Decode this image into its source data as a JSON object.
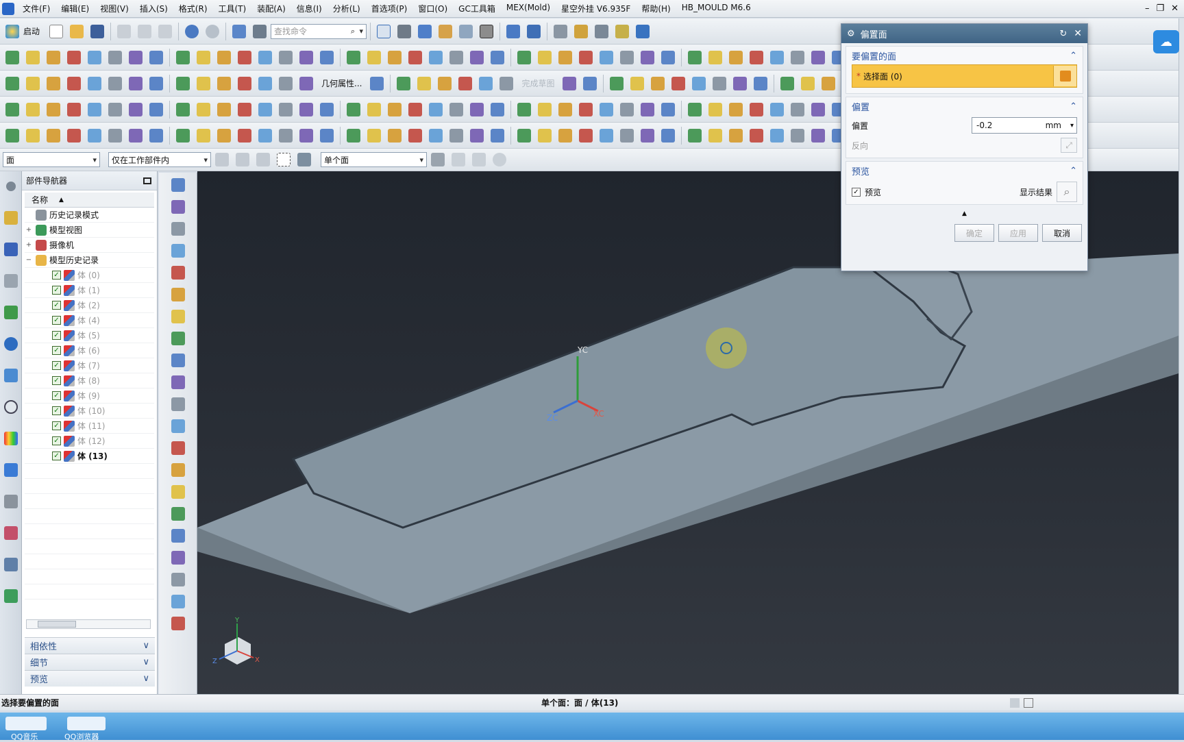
{
  "menubar": {
    "items": [
      "文件(F)",
      "编辑(E)",
      "视图(V)",
      "插入(S)",
      "格式(R)",
      "工具(T)",
      "装配(A)",
      "信息(I)",
      "分析(L)",
      "首选项(P)",
      "窗口(O)",
      "GC工具箱",
      "MEX(Mold)",
      "星空外挂 V6.935F",
      "帮助(H)",
      "HB_MOULD M6.6"
    ]
  },
  "toolbar": {
    "start_label": "启动",
    "search_placeholder": "查找命令",
    "geometry_props_label": "几何属性...",
    "finish_sketch_label": "完成草图",
    "filter_type": "面",
    "filter_scope": "仅在工作部件内",
    "face_rule": "单个面"
  },
  "navigator": {
    "title": "部件导航器",
    "column_name": "名称",
    "tree": [
      {
        "label": "历史记录模式",
        "level": 0,
        "toggle": "",
        "kind": "history"
      },
      {
        "label": "模型视图",
        "level": 0,
        "toggle": "+",
        "kind": "view"
      },
      {
        "label": "摄像机",
        "level": 0,
        "toggle": "+",
        "kind": "camera"
      },
      {
        "label": "模型历史记录",
        "level": 0,
        "toggle": "−",
        "kind": "folder"
      }
    ],
    "bodies": [
      "体 (0)",
      "体 (1)",
      "体 (2)",
      "体 (4)",
      "体 (5)",
      "体 (6)",
      "体 (7)",
      "体 (8)",
      "体 (9)",
      "体 (10)",
      "体 (11)",
      "体 (12)",
      "体 (13)"
    ],
    "accordion": [
      "相依性",
      "细节",
      "预览"
    ]
  },
  "dialog": {
    "title": "偏置面",
    "section_faces": "要偏置的面",
    "select_face": "选择面 (0)",
    "section_offset": "偏置",
    "offset_label": "偏置",
    "offset_value": "-0.2",
    "offset_unit": "mm",
    "reverse_label": "反向",
    "section_preview": "预览",
    "preview_label": "预览",
    "show_result": "显示结果",
    "ok": "确定",
    "apply": "应用",
    "cancel": "取消"
  },
  "viewport": {
    "axis_yc": "YC",
    "axis_xc": "XC",
    "axis_zc": "ZC",
    "triad_y": "Y",
    "triad_x": "X",
    "triad_z": "Z"
  },
  "status": {
    "prompt": "选择要偏置的面",
    "selection": "单个面：面 / 体(13)"
  },
  "taskbar": {
    "items": [
      "QQ音乐",
      "QQ浏览器"
    ]
  },
  "colors": {
    "accent": "#3f6485",
    "select_highlight": "#f7c445",
    "viewport_bg": "#2a2f37",
    "part_face": "#8a9aa6"
  }
}
